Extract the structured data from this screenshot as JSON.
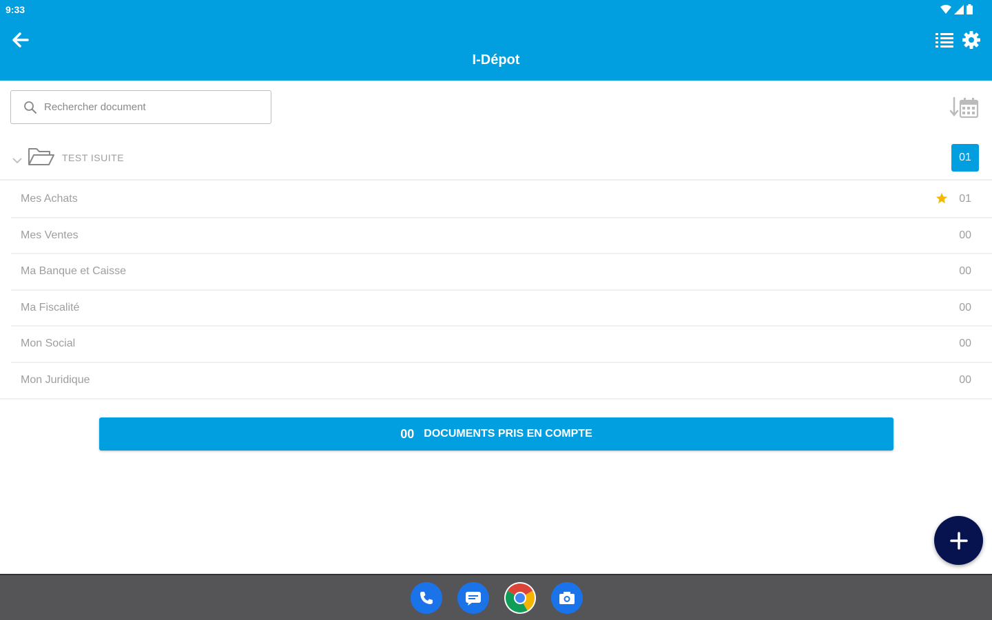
{
  "status_bar": {
    "time": "9:33"
  },
  "app_bar": {
    "title": "I-Dépot"
  },
  "search": {
    "placeholder": "Rechercher document"
  },
  "folder": {
    "name": "TEST ISUITE",
    "count": "01"
  },
  "categories": [
    {
      "label": "Mes Achats",
      "count": "01",
      "starred": true
    },
    {
      "label": "Mes Ventes",
      "count": "00",
      "starred": false
    },
    {
      "label": "Ma Banque et Caisse",
      "count": "00",
      "starred": false
    },
    {
      "label": "Ma Fiscalité",
      "count": "00",
      "starred": false
    },
    {
      "label": "Mon Social",
      "count": "00",
      "starred": false
    },
    {
      "label": "Mon Juridique",
      "count": "00",
      "starred": false
    }
  ],
  "documents_button": {
    "count": "00",
    "label": "DOCUMENTS PRIS EN COMPTE"
  },
  "colors": {
    "primary": "#019fe0",
    "fab": "#06134e",
    "navbar": "#555558",
    "star": "#f5b800"
  },
  "icons": [
    "back-arrow-icon",
    "list-icon",
    "gear-icon",
    "search-icon",
    "sort-calendar-icon",
    "chevron-down-icon",
    "folder-open-icon",
    "star-icon",
    "plus-icon",
    "phone-icon",
    "messages-icon",
    "chrome-icon",
    "camera-icon"
  ]
}
